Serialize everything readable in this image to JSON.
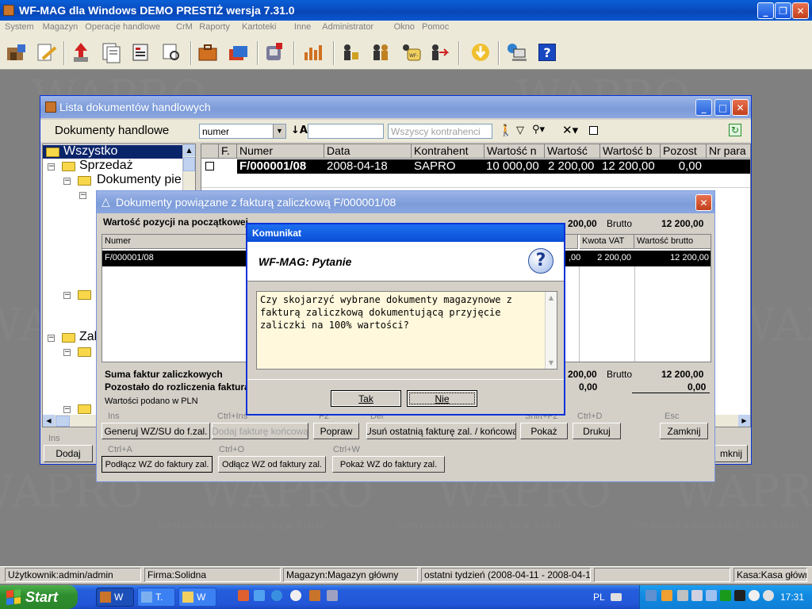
{
  "app": {
    "title": "WF-MAG dla Windows DEMO PRESTIŻ  wersja 7.31.0",
    "menu": [
      "System",
      "Magazyn",
      "Operacje handlowe",
      "CrM",
      "Raporty",
      "Kartoteki",
      "Inne",
      "Administrator",
      "Okno",
      "Pomoc"
    ]
  },
  "watermark": {
    "logo": "WAPRO",
    "tagline": "OPROGRAMOWANIE DLA FIRM"
  },
  "list_window": {
    "title": "Lista dokumentów handlowych",
    "toolbar_label": "Dokumenty handlowe",
    "sort_value": "numer",
    "contractor_placeholder": "Wszyscy kontrahenci",
    "tree": [
      "Wszystko",
      "Sprzedaż",
      "Dokumenty pie",
      "Zal"
    ],
    "columns": [
      "F.",
      "Numer",
      "Data",
      "Kontrahent",
      "Wartość n",
      "Wartość",
      "Wartość b",
      "Pozost",
      "Nr para"
    ],
    "row": {
      "numer": "F/000001/08",
      "data": "2008-04-18",
      "kontrahent": "SAPRO",
      "netto": "10 000,00",
      "vat": "2 200,00",
      "brutto": "12 200,00",
      "pozost": "0,00"
    },
    "ins_label": "Ins",
    "add_button": "Dodaj",
    "close_partial": "mknij"
  },
  "linked_dialog": {
    "title": "Dokumenty powiązane z fakturą zaliczkową F/000001/08",
    "header_text": "Wartość pozycji na początkowej",
    "header_value_partial": "200,00",
    "brutto_label": "Brutto",
    "brutto_value": "12 200,00",
    "columns": [
      "Numer",
      "Kwota VAT",
      "Wartość brutto"
    ],
    "row": {
      "numer": "F/000001/08",
      "partial": ",00",
      "kwota_vat": "2 200,00",
      "brutto": "12 200,00"
    },
    "sum_label": "Suma faktur zaliczkowych",
    "sum_partial": "200,00",
    "sum_brutto_label": "Brutto",
    "sum_brutto": "12 200,00",
    "remaining_label": "Pozostało do rozliczenia faktura",
    "remaining_value": "0,00",
    "remaining_value2": "0,00",
    "currency_note": "Wartości podano w PLN",
    "buttons_row1": [
      {
        "shortcut": "Ins",
        "label": "Generuj WZ/SU do f.zal."
      },
      {
        "shortcut": "Ctrl+Ins",
        "label": "Dodaj fakturę końcową"
      },
      {
        "shortcut": "F2",
        "label": "Popraw"
      },
      {
        "shortcut": "Del",
        "label": "Usuń ostatnią fakturę zal. / końcową"
      },
      {
        "shortcut": "Shift+F2",
        "label": "Pokaż"
      },
      {
        "shortcut": "Ctrl+D",
        "label": "Drukuj"
      },
      {
        "shortcut": "Esc",
        "label": "Zamknij"
      }
    ],
    "buttons_row2": [
      {
        "shortcut": "Ctrl+A",
        "label": "Podłącz WZ do faktury zal."
      },
      {
        "shortcut": "Ctrl+O",
        "label": "Odłącz WZ od faktury zal."
      },
      {
        "shortcut": "Ctrl+W",
        "label": "Pokaż WZ do faktury zal."
      }
    ]
  },
  "message": {
    "title": "Komunikat",
    "heading": "WF-MAG: Pytanie",
    "text": "Czy skojarzyć wybrane dokumenty magazynowe z fakturą zaliczkową dokumentującą przyjęcie zaliczki na 100% wartości?",
    "yes": "Tak",
    "no": "Nie"
  },
  "status_bar": [
    "Użytkownik:admin/admin",
    "Firma:Solidna",
    "Magazyn:Magazyn główny",
    "ostatni tydzień (2008-04-11 - 2008-04-18)",
    "",
    "Kasa:Kasa główn"
  ],
  "taskbar": {
    "start": "Start",
    "tasks": [
      "W",
      "T.",
      "W"
    ],
    "lang": "PL",
    "time": "17:31"
  },
  "colors": {
    "xp_title": "#0a5fd6",
    "desktop": "#808080",
    "selection": "#000000"
  }
}
